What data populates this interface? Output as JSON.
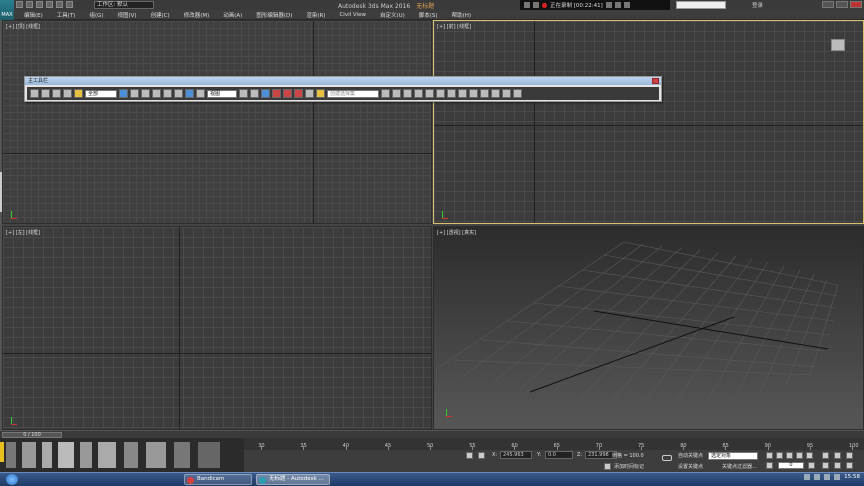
{
  "app": {
    "title": "Autodesk 3ds Max 2016",
    "document": "无标题",
    "logo_text": "MAX",
    "workspace": "工作区: 默认"
  },
  "recorder": {
    "text": "正在录制 [00:22:41]"
  },
  "header_right": {
    "login_label": "登录"
  },
  "menu": [
    "编辑(E)",
    "工具(T)",
    "组(G)",
    "视图(V)",
    "创建(C)",
    "修改器(M)",
    "动画(A)",
    "图形编辑器(D)",
    "渲染(R)",
    "Civil View",
    "自定义(U)",
    "脚本(S)",
    "帮助(H)"
  ],
  "viewports": {
    "top": "[+] [顶] [线框]",
    "front": "[+] [前] [线框]",
    "left": "[+] [左] [线框]",
    "perspective": "[+] [透视] [真实]"
  },
  "main_toolbar": {
    "title": "主工具栏",
    "filter_value": "全部",
    "refcoord_value": "视图",
    "named_selection_placeholder": "创建选择集"
  },
  "timeline": {
    "frame_counter": "0 / 100",
    "ticks": [
      "0",
      "5",
      "10",
      "15",
      "20",
      "25",
      "30",
      "35",
      "40",
      "45",
      "50",
      "55",
      "60",
      "65",
      "70",
      "75",
      "80",
      "85",
      "90",
      "95",
      "100"
    ]
  },
  "status": {
    "x_label": "X:",
    "x_value": "245.963",
    "y_label": "Y:",
    "y_value": "0.0",
    "z_label": "Z:",
    "z_value": "231.998",
    "grid_text": "栅格 = 100.0",
    "add_time_tag": "添加时间标记",
    "auto_key": "自动关键点",
    "set_key": "设置关键点",
    "selected_object": "选定对象",
    "key_filters": "关键点过滤器...",
    "current_frame": "0"
  },
  "taskbar": {
    "items": [
      {
        "label": "Bandicam",
        "color": "#d84040"
      },
      {
        "label": "无标题 - Autodesk ...",
        "color": "#2a9fb0"
      }
    ],
    "clock": "15:58"
  }
}
